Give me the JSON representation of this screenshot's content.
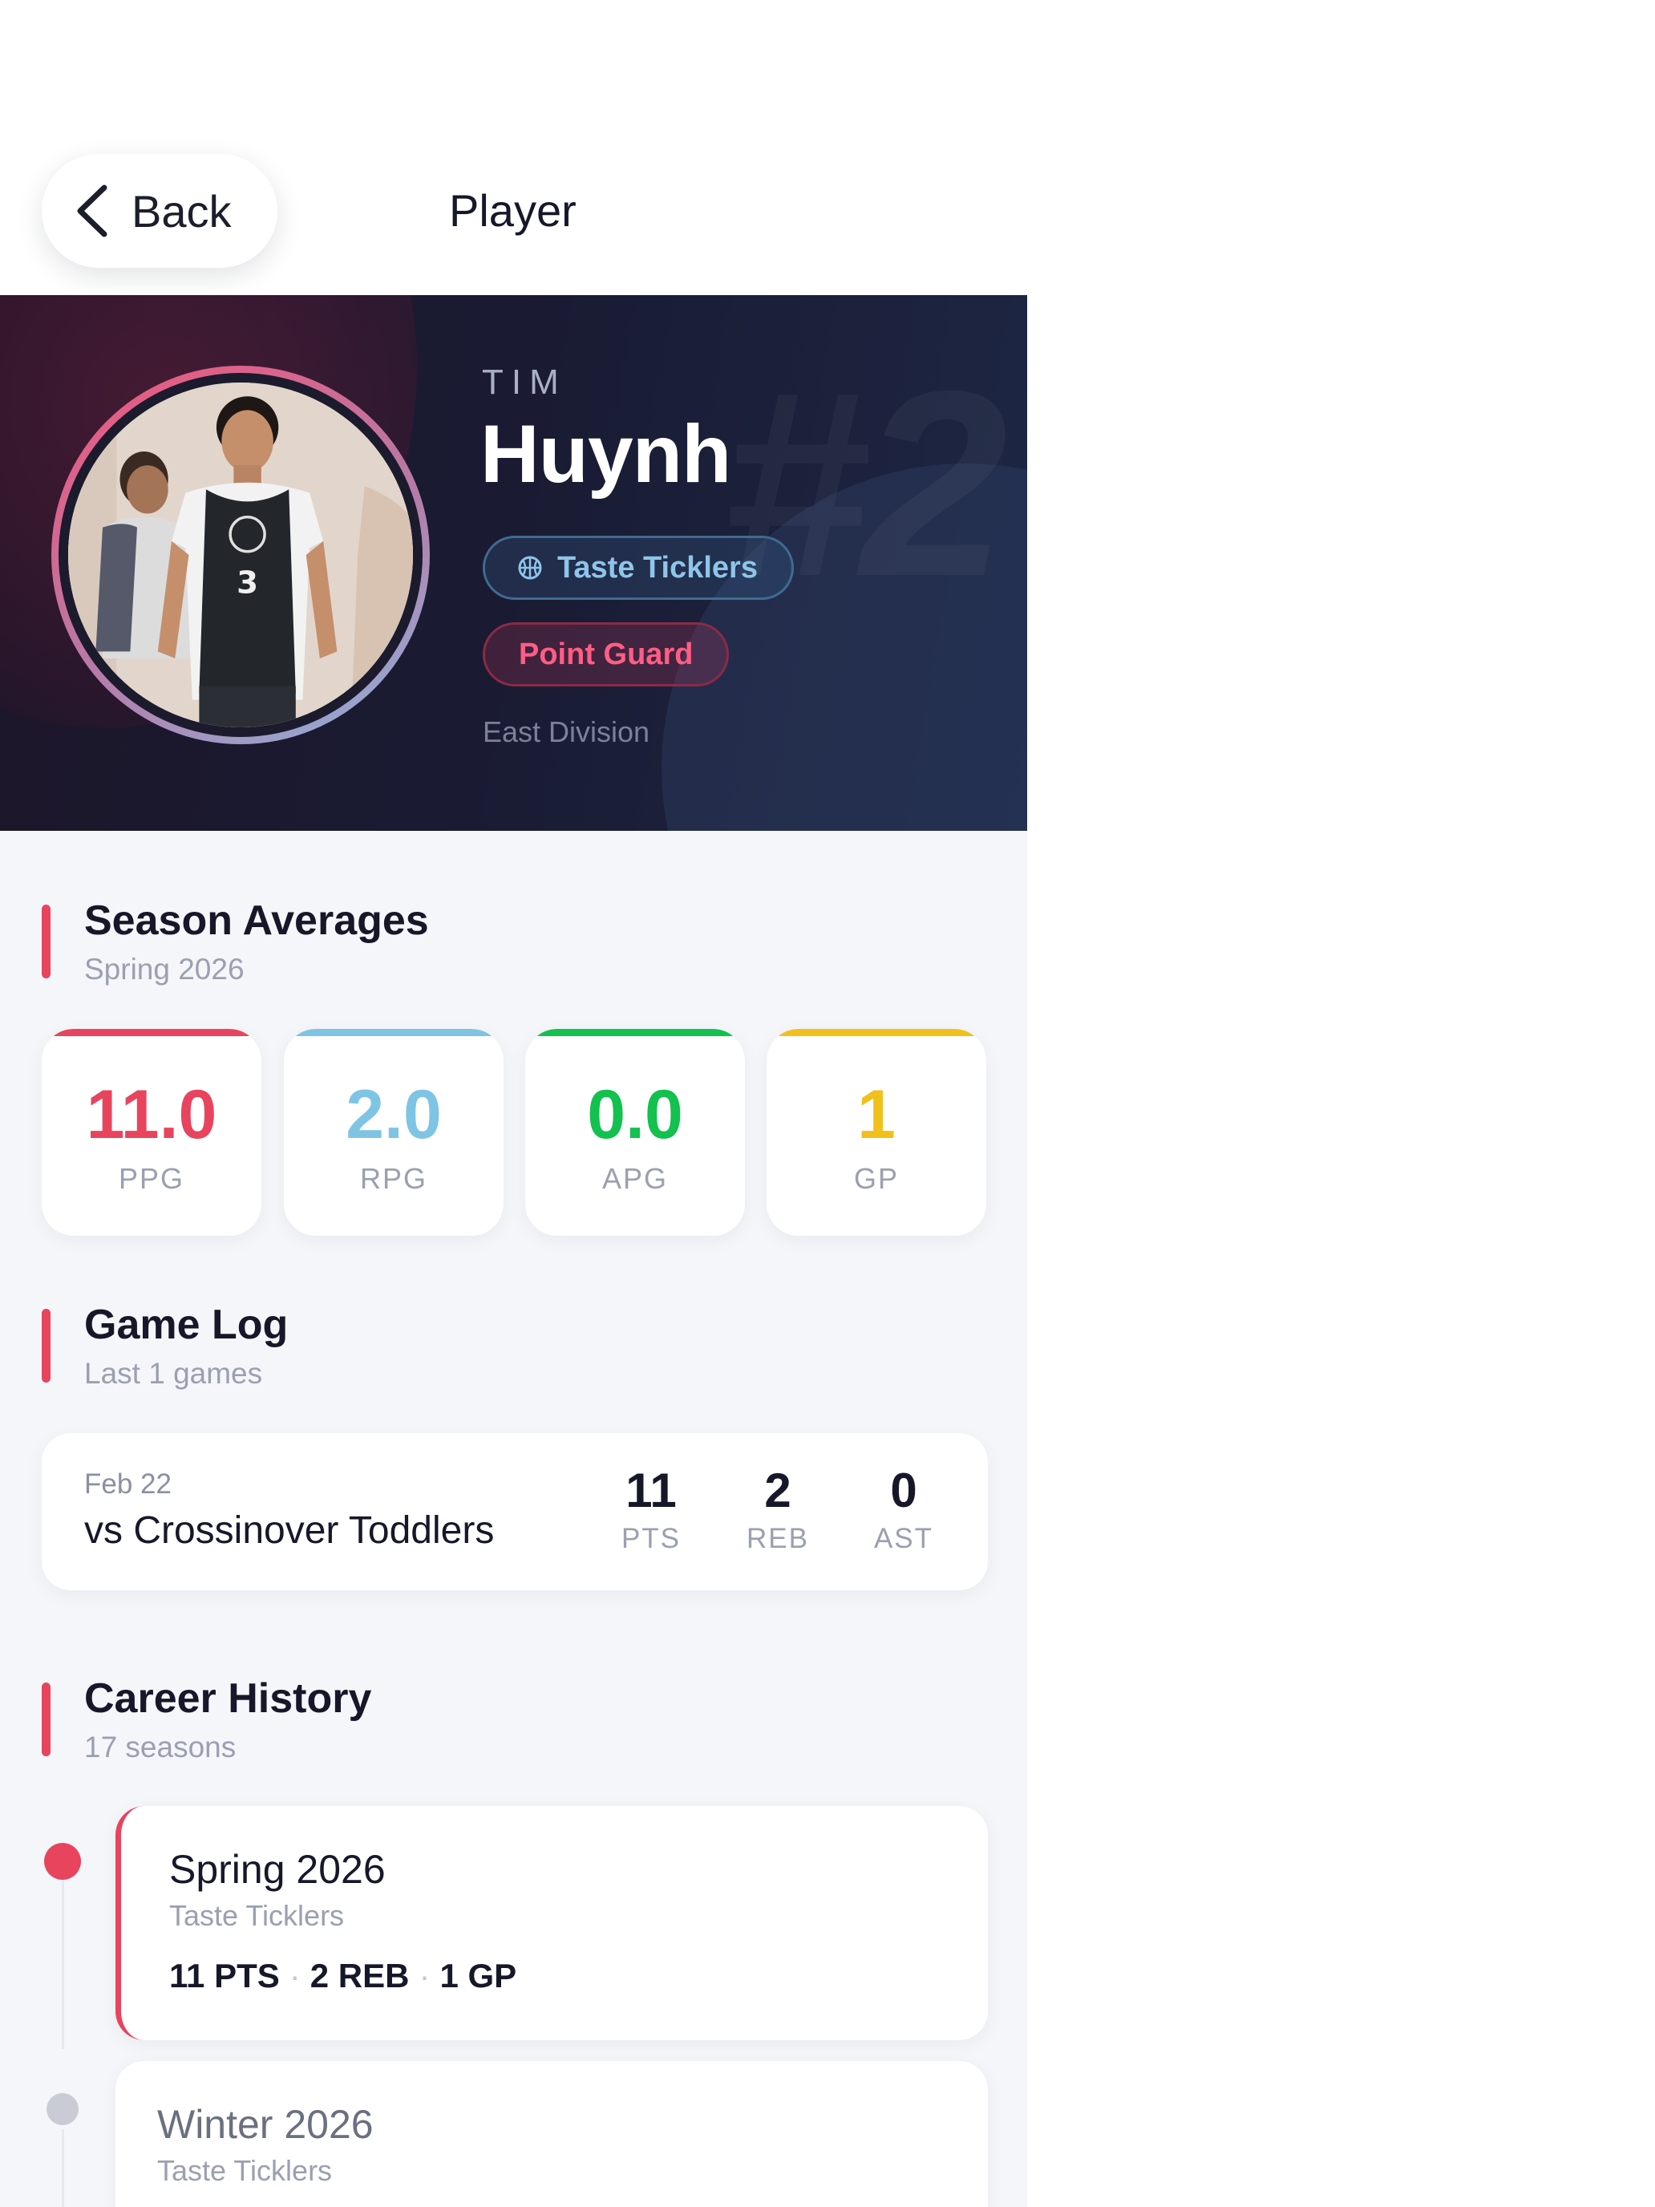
{
  "nav": {
    "back_label": "Back",
    "title": "Player"
  },
  "player": {
    "first_name": "TIM",
    "last_name": "Huynh",
    "jersey_watermark": "#2",
    "team": "Taste Ticklers",
    "position": "Point Guard",
    "division": "East Division"
  },
  "season_averages": {
    "title": "Season Averages",
    "subtitle": "Spring 2026",
    "stats": [
      {
        "value": "11.0",
        "label": "PPG",
        "color": "#e8445e"
      },
      {
        "value": "2.0",
        "label": "RPG",
        "color": "#7ec4e4"
      },
      {
        "value": "0.0",
        "label": "APG",
        "color": "#12c14e"
      },
      {
        "value": "1",
        "label": "GP",
        "color": "#f2c01c"
      }
    ]
  },
  "game_log": {
    "title": "Game Log",
    "subtitle": "Last 1 games",
    "games": [
      {
        "date": "Feb 22",
        "opponent": "vs Crossinover Toddlers",
        "stats": [
          {
            "value": "11",
            "label": "PTS"
          },
          {
            "value": "2",
            "label": "REB"
          },
          {
            "value": "0",
            "label": "AST"
          }
        ]
      }
    ]
  },
  "career": {
    "title": "Career History",
    "subtitle": "17 seasons",
    "seasons": [
      {
        "name": "Spring 2026",
        "team": "Taste Ticklers",
        "pts": "11 PTS",
        "reb": "2 REB",
        "gp": "1 GP"
      },
      {
        "name": "Winter 2026",
        "team": "Taste Ticklers"
      }
    ]
  },
  "colors": {
    "accent": "#e8445e",
    "hero_bg": "#1a1b33",
    "page_bg": "#f5f6fa"
  }
}
